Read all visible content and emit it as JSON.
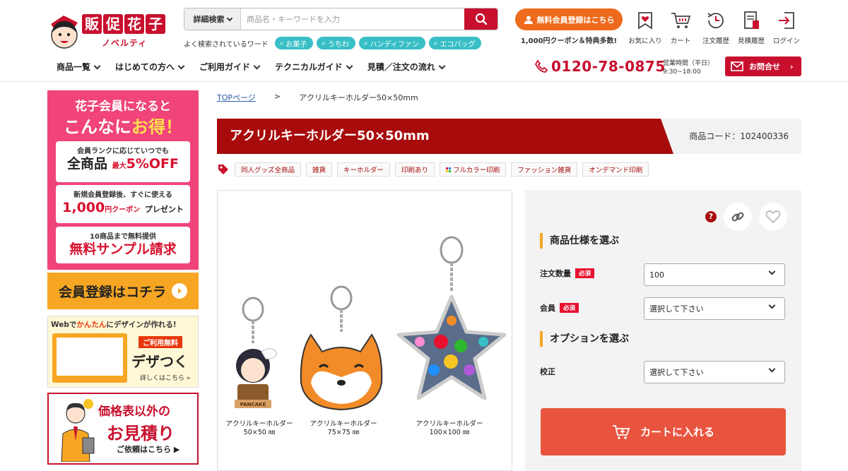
{
  "header": {
    "logo": {
      "title_chars": [
        "販",
        "促",
        "花",
        "子"
      ],
      "sub": "ノベルティ"
    },
    "search": {
      "detail_label": "詳細検索",
      "placeholder": "商品名・キーワードを入力"
    },
    "popular": {
      "label": "よく検索されているワード",
      "tags": [
        "お菓子",
        "うちわ",
        "ハンディファン",
        "エコバッグ"
      ]
    },
    "member": {
      "button": "無料会員登録はこちら",
      "note": "1,000円クーポン＆特典多数!"
    },
    "icons": [
      {
        "name": "favorite-icon",
        "label": "お気に入り"
      },
      {
        "name": "cart-icon",
        "label": "カート"
      },
      {
        "name": "history-icon",
        "label": "注文履歴"
      },
      {
        "name": "estimate-icon",
        "label": "見積履歴"
      },
      {
        "name": "login-icon",
        "label": "ログイン"
      }
    ],
    "nav": [
      "商品一覧",
      "はじめての方へ",
      "ご利用ガイド",
      "テクニカルガイド",
      "見積／注文の流れ"
    ],
    "phone": "0120-78-0875",
    "hours": {
      "line1": "営業時間（平日）",
      "line2": "9:30~18:00"
    },
    "contact": "お問合せ"
  },
  "sidebar": {
    "banner1": {
      "head1": "花子会員になると",
      "head2_a": "こんなに",
      "head2_b": "お得！",
      "card1": {
        "small": "会員ランクに応じていつでも",
        "big_a": "全商品",
        "big_sm": "最大",
        "big_b": "5%OFF"
      },
      "card2": {
        "small": "新規会員登録後、すぐに使える",
        "big_a": "1,000",
        "big_sm": "円クーポン",
        "big_b": "プレゼント"
      },
      "card3": {
        "small": "10商品まで無料提供",
        "big": "無料サンプル請求"
      }
    },
    "banner2": "会員登録はコチラ",
    "banner3": {
      "top_a": "Webで",
      "top_hl": "かんたん",
      "top_b": "にデザインが作れる!",
      "free": "ご利用無料",
      "name": "デザつく",
      "more": "詳しくはこちら »"
    },
    "banner4": {
      "t1": "価格表以外の",
      "t2": "お見積り",
      "t3": "ご依頼はこちら ▶"
    }
  },
  "breadcrumb": {
    "home": "TOPページ",
    "sep": ">",
    "current": "アクリルキーホルダー50×50mm"
  },
  "product": {
    "title": "アクリルキーホルダー50×50mm",
    "code": "商品コード：102400336",
    "tags": [
      "同人グッズ全商品",
      "雑貨",
      "キーホルダー",
      "印刷あり",
      "フルカラー印刷",
      "ファッション雑貨",
      "オンデマンド印刷"
    ],
    "images": [
      {
        "cap1": "アクリルキーホルダー",
        "cap2": "50×50 ㎜",
        "print": "PANCAKE"
      },
      {
        "cap1": "アクリルキーホルダー",
        "cap2": "75×75 ㎜"
      },
      {
        "cap1": "アクリルキーホルダー",
        "cap2": "100×100 ㎜"
      }
    ]
  },
  "spec": {
    "section1": "商品仕様を選ぶ",
    "qty": {
      "label": "注文数量",
      "required": "必須",
      "value": "100"
    },
    "member": {
      "label": "会員",
      "required": "必須",
      "value": "選択して下さい"
    },
    "section2": "オプションを選ぶ",
    "proof": {
      "label": "校正",
      "value": "選択して下さい"
    },
    "cart_button": "カートに入れる"
  },
  "colors": {
    "brand_red": "#c8102e",
    "title_red": "#a80b0b",
    "accent_orange": "#ee6b1d",
    "cart": "#e9543e",
    "chip": "#38bfc6"
  }
}
